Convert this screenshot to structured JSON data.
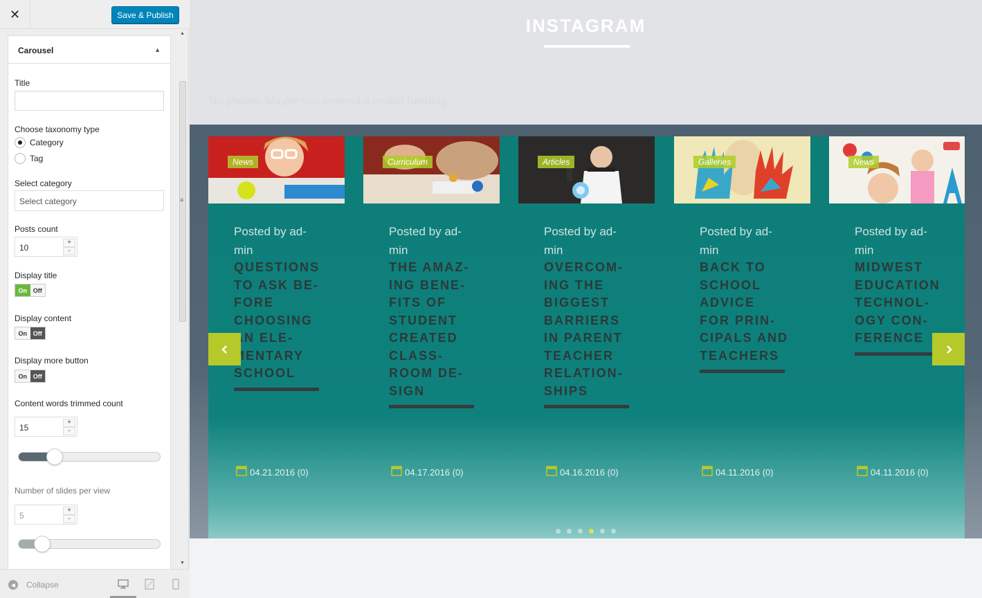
{
  "header": {
    "close_label": "✕",
    "save_label": "Save & Publish"
  },
  "section": {
    "title": "Carousel",
    "title_field_label": "Title",
    "title_field_value": "",
    "taxonomy_label": "Choose taxonomy type",
    "taxonomy_options": [
      "Category",
      "Tag"
    ],
    "taxonomy_selected": "Category",
    "select_category_label": "Select category",
    "select_category_placeholder": "Select category",
    "posts_count_label": "Posts count",
    "posts_count_value": "10",
    "display_title_label": "Display title",
    "display_title_state": "on",
    "display_content_label": "Display content",
    "display_content_state": "off",
    "display_more_label": "Display more button",
    "display_more_state": "off",
    "toggle_on": "On",
    "toggle_off": "Off",
    "trim_label": "Content words trimmed count",
    "trim_value": "15",
    "trim_slider_fraction": 0.25,
    "slides_label": "Number of slides per view",
    "slides_value": "5",
    "slides_slider_fraction": 0.1,
    "stepper_plus": "+",
    "stepper_minus": "-"
  },
  "footer": {
    "collapse_label": "Collapse",
    "devices": [
      "desktop-icon",
      "tablet-icon",
      "mobile-icon"
    ]
  },
  "preview": {
    "instagram_title": "INSTAGRAM",
    "no_photos_text": "No photos. Maybe you entered a invalid hashtag.",
    "posts": [
      {
        "category": "News",
        "author": "Posted by ad-min",
        "title": "QUESTIONS TO ASK BE-FORE CHOOSING AN ELE-MENTARY SCHOOL",
        "date": "04.21.2016 (0)"
      },
      {
        "category": "Curriculum",
        "author": "Posted by ad-min",
        "title": "THE AMAZ-ING BENE-FITS OF STUDENT CREATED CLASS-ROOM DE-SIGN",
        "date": "04.17.2016 (0)"
      },
      {
        "category": "Articles",
        "author": "Posted by ad-min",
        "title": "OVERCOM-ING THE BIGGEST BARRIERS IN PARENT TEACHER RELATION-SHIPS",
        "date": "04.16.2016 (0)"
      },
      {
        "category": "Galleries",
        "author": "Posted by ad-min",
        "title": "BACK TO SCHOOL ADVICE FOR PRIN-CIPALS AND TEACHERS",
        "date": "04.11.2016 (0)"
      },
      {
        "category": "News",
        "author": "Posted by ad-min",
        "title": "MIDWEST EDUCATION TECHNOL-OGY CON-FERENCE",
        "date": "04.11.2016 (0)"
      }
    ],
    "prev_icon": "chevron-left-icon",
    "next_icon": "chevron-right-icon",
    "dots_count": 6,
    "active_dot": 3,
    "accent_color": "#b5c92b",
    "carousel_color": "#0d7d78"
  }
}
